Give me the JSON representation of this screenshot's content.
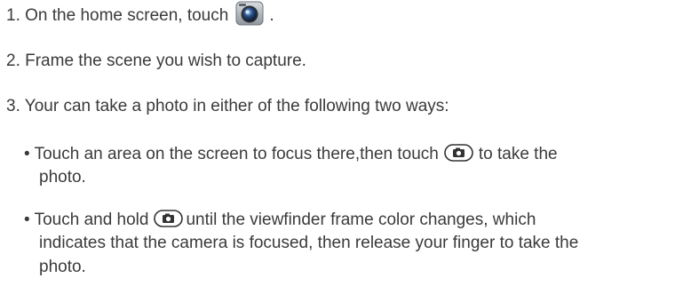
{
  "steps": {
    "step1_before_icon": "1. On the home screen, touch",
    "step1_after_icon": ".",
    "step2": "2. Frame the scene you wish to capture.",
    "step3": "3. Your can take a photo in either of the following two ways:"
  },
  "bullets": {
    "b1_before_icon": "• Touch an area on the screen to focus there,then touch",
    "b1_after_icon": "to take the",
    "b1_line2": "photo.",
    "b2_before_icon": "• Touch and hold",
    "b2_after_icon": "until the viewfinder frame color changes, which",
    "b2_line2": "indicates that the camera is focused, then release your finger to take the",
    "b2_line3": "photo."
  },
  "icons": {
    "camera_app": "camera-app-icon",
    "shutter": "shutter-button-icon"
  }
}
